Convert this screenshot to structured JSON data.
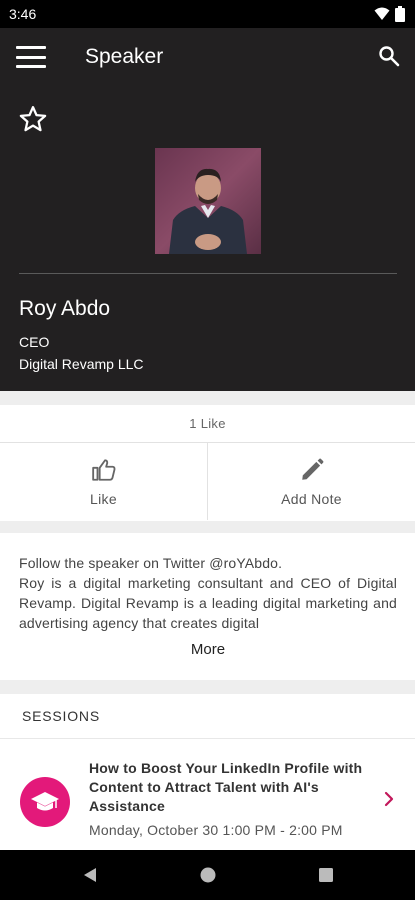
{
  "status_bar": {
    "time": "3:46"
  },
  "app_bar": {
    "title": "Speaker"
  },
  "speaker": {
    "name": "Roy Abdo",
    "role": "CEO",
    "company": "Digital Revamp LLC"
  },
  "likes": {
    "count_text": "1 Like"
  },
  "actions": {
    "like_label": "Like",
    "note_label": "Add Note"
  },
  "bio": {
    "text": "Follow the speaker on Twitter @roYAbdo.\nRoy is a digital marketing consultant and CEO of Digital Revamp. Digital Revamp is a leading digital marketing and advertising agency that creates digital",
    "more_label": "More"
  },
  "sessions": {
    "header": "SESSIONS",
    "items": [
      {
        "title": "How to Boost Your LinkedIn Profile with Content to Attract Talent with AI's Assistance",
        "time": "Monday, October 30 1:00 PM - 2:00 PM",
        "icon": "graduation-cap-icon"
      }
    ]
  },
  "colors": {
    "header_bg": "#222021",
    "accent": "#e3197a",
    "chevron": "#c2185b"
  }
}
